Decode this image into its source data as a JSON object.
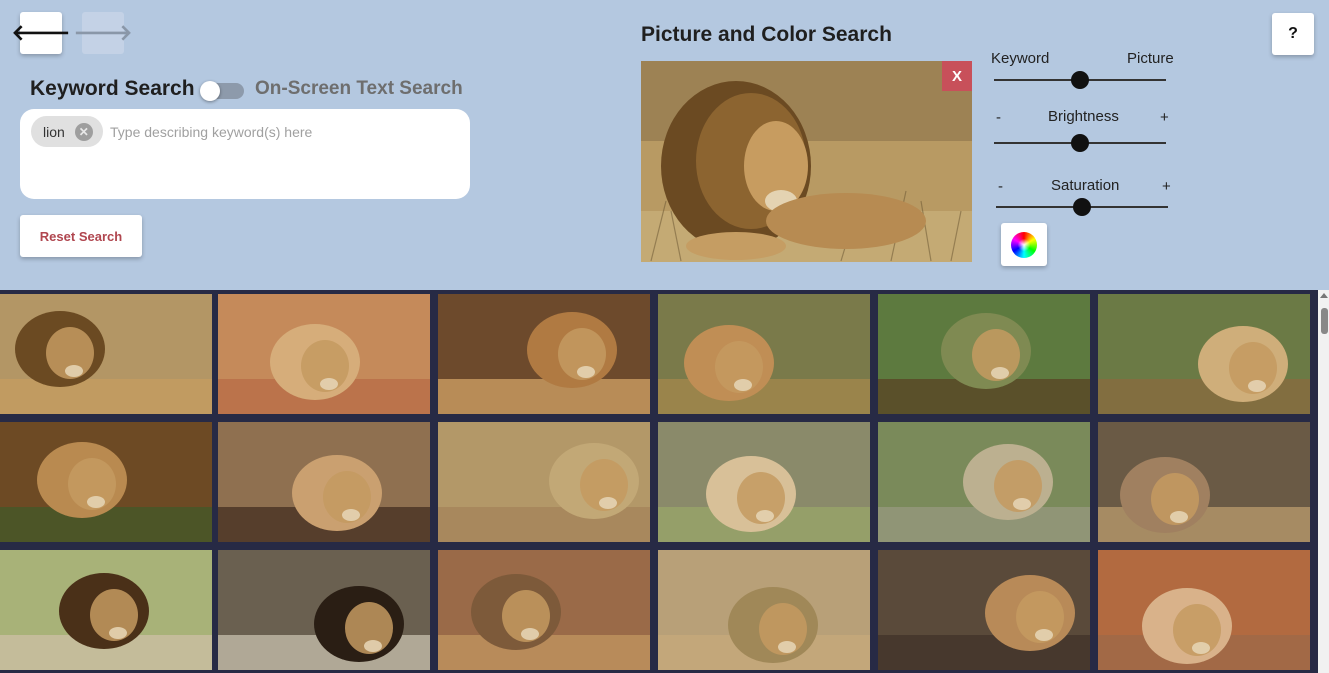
{
  "nav": {
    "back_icon": "arrow-left-icon",
    "back_glyph": "🡐",
    "forward_icon": "arrow-right-icon",
    "forward_glyph": "🡒",
    "help_label": "?"
  },
  "keyword_search": {
    "title": "Keyword Search",
    "toggle_on": false,
    "alt_title": "On-Screen Text Search",
    "chips": [
      {
        "label": "lion",
        "remove_glyph": "✕"
      }
    ],
    "placeholder": "Type describing keyword(s) here",
    "value": "",
    "reset_label": "Reset Search"
  },
  "picture_search": {
    "title": "Picture and Color Search",
    "close_label": "X",
    "sliders": [
      {
        "left": "Keyword",
        "center": "",
        "right": "Picture",
        "value": 0.5
      },
      {
        "left": "-",
        "center": "Brightness",
        "right": "+",
        "value": 0.5
      },
      {
        "left": "-",
        "center": "Saturation",
        "right": "+",
        "value": 0.5
      }
    ],
    "color_picker_icon": "color-wheel-icon"
  },
  "results": {
    "rows": 3,
    "columns": 6,
    "items": [
      {
        "subject": "lion"
      },
      {
        "subject": "lion"
      },
      {
        "subject": "lion"
      },
      {
        "subject": "lion"
      },
      {
        "subject": "lion"
      },
      {
        "subject": "lion"
      },
      {
        "subject": "lion"
      },
      {
        "subject": "lion"
      },
      {
        "subject": "lion"
      },
      {
        "subject": "lion"
      },
      {
        "subject": "lion"
      },
      {
        "subject": "lion"
      },
      {
        "subject": "lion"
      },
      {
        "subject": "lion"
      },
      {
        "subject": "lion"
      },
      {
        "subject": "lion"
      },
      {
        "subject": "lion"
      },
      {
        "subject": "lion"
      }
    ]
  },
  "colors": {
    "panel_bg": "#b4c8e0",
    "grid_bg": "#272a45",
    "accent_red": "#c8505a",
    "reset_text": "#b0464f"
  }
}
